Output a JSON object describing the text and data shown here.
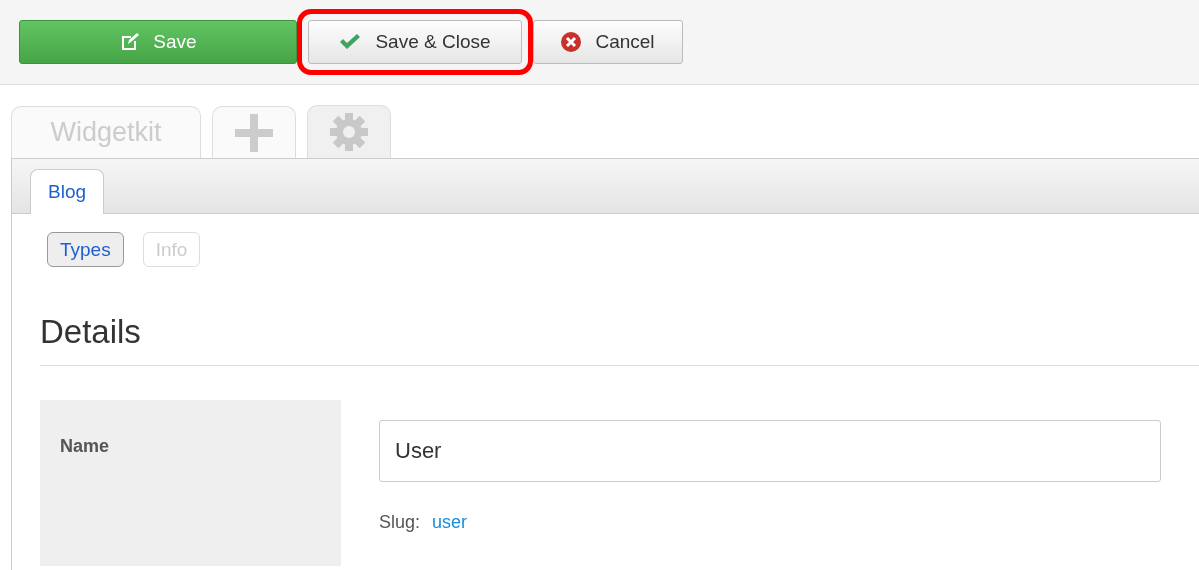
{
  "toolbar": {
    "buttons": [
      {
        "kind": "save",
        "label": "Save",
        "highlighted": false
      },
      {
        "kind": "check",
        "label": "Save & Close",
        "highlighted": true
      },
      {
        "kind": "cancel",
        "label": "Cancel",
        "highlighted": false
      }
    ]
  },
  "tabs": [
    {
      "kind": "text",
      "label": "Widgetkit",
      "selected": false
    },
    {
      "kind": "plus",
      "selected": false
    },
    {
      "kind": "gear",
      "selected": true
    }
  ],
  "subtabs": [
    {
      "label": "Blog",
      "selected": true
    }
  ],
  "pills": [
    {
      "label": "Types",
      "selected": true
    },
    {
      "label": "Info",
      "selected": false
    }
  ],
  "heading": "Details",
  "field": {
    "label": "Name",
    "value": "User",
    "slug_label": "Slug:",
    "slug": "user"
  }
}
